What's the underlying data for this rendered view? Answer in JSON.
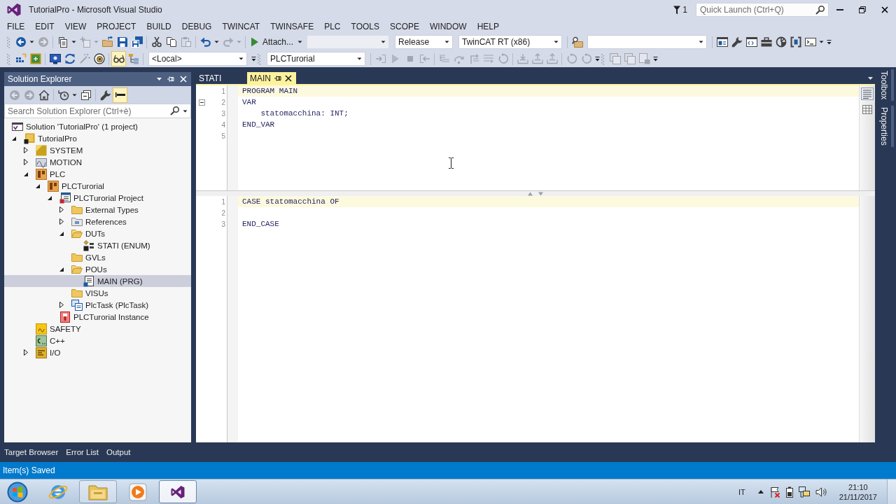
{
  "window": {
    "title": "TutorialPro - Microsoft Visual Studio",
    "notification_count": "1",
    "quick_launch": {
      "placeholder": "Quick Launch (Ctrl+Q)"
    }
  },
  "menu": [
    "FILE",
    "EDIT",
    "VIEW",
    "PROJECT",
    "BUILD",
    "DEBUG",
    "TWINCAT",
    "TWINSAFE",
    "PLC",
    "TOOLS",
    "SCOPE",
    "WINDOW",
    "HELP"
  ],
  "toolbar_1": [
    {
      "kind": "grip"
    },
    {
      "kind": "back",
      "disabled": false
    },
    {
      "kind": "dropdown",
      "disabled": false
    },
    {
      "kind": "forward",
      "disabled": true
    },
    {
      "kind": "separator"
    },
    {
      "kind": "new-project",
      "disabled": false
    },
    {
      "kind": "dropdown",
      "disabled": false
    },
    {
      "kind": "add-item",
      "disabled": true
    },
    {
      "kind": "dropdown",
      "disabled": true
    },
    {
      "kind": "open",
      "disabled": false
    },
    {
      "kind": "save",
      "disabled": false
    },
    {
      "kind": "save-all",
      "disabled": false
    },
    {
      "kind": "separator"
    },
    {
      "kind": "cut",
      "disabled": false
    },
    {
      "kind": "copy",
      "disabled": false
    },
    {
      "kind": "paste",
      "disabled": true
    },
    {
      "kind": "separator"
    },
    {
      "kind": "undo",
      "disabled": false
    },
    {
      "kind": "dropdown",
      "disabled": false
    },
    {
      "kind": "redo",
      "disabled": true
    },
    {
      "kind": "dropdown",
      "disabled": true
    },
    {
      "kind": "separator"
    },
    {
      "kind": "start",
      "label": "Attach...",
      "disabled": false
    },
    {
      "kind": "dropdown",
      "disabled": false
    },
    {
      "kind": "combo",
      "disabled": true
    },
    {
      "kind": "combo",
      "value": "Release",
      "disabled": false
    },
    {
      "kind": "combo",
      "value": "TwinCAT RT (x86)",
      "disabled": false
    },
    {
      "kind": "separator"
    },
    {
      "kind": "find-files",
      "disabled": false
    },
    {
      "kind": "combo",
      "disabled": false
    },
    {
      "kind": "separator"
    },
    {
      "kind": "solution-explorer",
      "disabled": false
    },
    {
      "kind": "properties",
      "disabled": false
    },
    {
      "kind": "code-window",
      "disabled": false
    },
    {
      "kind": "toolbox",
      "disabled": false
    },
    {
      "kind": "gauge",
      "disabled": false
    },
    {
      "kind": "brackets",
      "disabled": false
    },
    {
      "kind": "console",
      "disabled": false
    },
    {
      "kind": "dropdown",
      "disabled": false
    },
    {
      "kind": "overflow"
    }
  ],
  "toolbar_2": [
    {
      "kind": "grip"
    },
    {
      "kind": "grid-arrow",
      "disabled": false
    },
    {
      "kind": "chip",
      "disabled": false
    },
    {
      "kind": "separator"
    },
    {
      "kind": "monitor",
      "disabled": false
    },
    {
      "kind": "reload",
      "disabled": false
    },
    {
      "kind": "wand",
      "disabled": true
    },
    {
      "kind": "target",
      "disabled": false
    },
    {
      "kind": "separator"
    },
    {
      "kind": "glasses",
      "disabled": false,
      "checked": true
    },
    {
      "kind": "hierarchy",
      "disabled": false
    },
    {
      "kind": "separator"
    },
    {
      "kind": "combo",
      "value": "<Local>",
      "disabled": false
    },
    {
      "kind": "overflow"
    },
    {
      "kind": "grip"
    },
    {
      "kind": "combo",
      "value": "PLCTurorial",
      "disabled": false
    },
    {
      "kind": "separator"
    },
    {
      "kind": "login",
      "disabled": true
    },
    {
      "kind": "start",
      "disabled": true
    },
    {
      "kind": "stop",
      "disabled": true
    },
    {
      "kind": "logout",
      "disabled": true
    },
    {
      "kind": "separator"
    },
    {
      "kind": "step-into",
      "disabled": true
    },
    {
      "kind": "step-over",
      "disabled": true
    },
    {
      "kind": "step-out",
      "disabled": true
    },
    {
      "kind": "run-to-cursor",
      "disabled": true
    },
    {
      "kind": "reset",
      "disabled": true
    },
    {
      "kind": "separator"
    },
    {
      "kind": "tray-down",
      "disabled": true
    },
    {
      "kind": "tray-up",
      "disabled": true
    },
    {
      "kind": "tray-up",
      "disabled": true
    },
    {
      "kind": "separator"
    },
    {
      "kind": "reset",
      "disabled": true
    },
    {
      "kind": "reset",
      "disabled": true
    },
    {
      "kind": "overflow"
    },
    {
      "kind": "grip"
    },
    {
      "kind": "window-split",
      "disabled": true
    },
    {
      "kind": "window-split",
      "disabled": true
    },
    {
      "kind": "window-lock",
      "disabled": true
    },
    {
      "kind": "overflow"
    }
  ],
  "solution_explorer": {
    "title": "Solution Explorer",
    "toolbar": [
      {
        "kind": "back",
        "disabled": true
      },
      {
        "kind": "forward",
        "disabled": true
      },
      {
        "kind": "home",
        "disabled": false
      },
      {
        "kind": "separator"
      },
      {
        "kind": "history",
        "disabled": false
      },
      {
        "kind": "dropdown",
        "disabled": false
      },
      {
        "kind": "collapse-all",
        "disabled": false
      },
      {
        "kind": "separator"
      },
      {
        "kind": "properties",
        "disabled": false
      },
      {
        "kind": "preview",
        "disabled": false,
        "checked": true
      }
    ],
    "search": {
      "placeholder": "Search Solution Explorer (Ctrl+è)"
    },
    "tree": [
      {
        "label": "Solution 'TutorialPro' (1 project)",
        "kind": "solution",
        "selected": false,
        "children": [
          {
            "label": "TutorialPro",
            "kind": "twincat-project",
            "expanded": true,
            "selected": false,
            "children": [
              {
                "label": "SYSTEM",
                "kind": "system",
                "expanded": false,
                "selected": false
              },
              {
                "label": "MOTION",
                "kind": "motion",
                "expanded": false,
                "selected": false
              },
              {
                "label": "PLC",
                "kind": "plc",
                "expanded": true,
                "selected": false,
                "children": [
                  {
                    "label": "PLCTurorial",
                    "kind": "plc-project",
                    "expanded": true,
                    "selected": false,
                    "children": [
                      {
                        "label": "PLCTurorial Project",
                        "kind": "plc-project-file",
                        "expanded": true,
                        "selected": false,
                        "children": [
                          {
                            "label": "External Types",
                            "kind": "folder",
                            "expanded": false,
                            "selected": false
                          },
                          {
                            "label": "References",
                            "kind": "references",
                            "expanded": false,
                            "selected": false
                          },
                          {
                            "label": "DUTs",
                            "kind": "folder",
                            "expanded": true,
                            "selected": false,
                            "children": [
                              {
                                "label": "STATI (ENUM)",
                                "kind": "enum",
                                "selected": false
                              }
                            ]
                          },
                          {
                            "label": "GVLs",
                            "kind": "folder",
                            "selected": false
                          },
                          {
                            "label": "POUs",
                            "kind": "folder",
                            "expanded": true,
                            "selected": false,
                            "children": [
                              {
                                "label": "MAIN (PRG)",
                                "kind": "program",
                                "selected": true
                              }
                            ]
                          },
                          {
                            "label": "VISUs",
                            "kind": "folder",
                            "selected": false
                          },
                          {
                            "label": "PlcTask (PlcTask)",
                            "kind": "task",
                            "expanded": false,
                            "selected": false
                          }
                        ]
                      },
                      {
                        "label": "PLCTurorial Instance",
                        "kind": "instance",
                        "selected": false
                      }
                    ]
                  }
                ]
              },
              {
                "label": "SAFETY",
                "kind": "safety",
                "selected": false
              },
              {
                "label": "C++",
                "kind": "cpp",
                "selected": false
              },
              {
                "label": "I/O",
                "kind": "io",
                "expanded": false,
                "selected": false
              }
            ]
          }
        ]
      }
    ]
  },
  "editor": {
    "tabs": [
      {
        "label": "STATI",
        "selected": false
      },
      {
        "label": "MAIN",
        "selected": true
      }
    ],
    "declaration_views": [
      {
        "kind": "text",
        "selected": true
      },
      {
        "kind": "table",
        "selected": false
      }
    ],
    "declaration": [
      {
        "number": "1",
        "code": "PROGRAM MAIN",
        "current": true
      },
      {
        "number": "2",
        "code": "VAR",
        "current": false,
        "fold_marker": true
      },
      {
        "number": "3",
        "code": "    statomacchina: INT;",
        "current": false
      },
      {
        "number": "4",
        "code": "END_VAR",
        "current": false
      },
      {
        "number": "5",
        "current": false
      }
    ],
    "implementation": [
      {
        "number": "1",
        "code": "CASE statomacchina OF",
        "current": true
      },
      {
        "number": "2",
        "current": false
      },
      {
        "number": "3",
        "code": "END_CASE",
        "current": false
      }
    ]
  },
  "side_tabs": [
    "Toolbox",
    "Properties"
  ],
  "bottom_tabs": [
    "Target Browser",
    "Error List",
    "Output"
  ],
  "status_bar": {
    "message": "Item(s) Saved"
  },
  "taskbar": {
    "apps": [
      {
        "kind": "browser",
        "running": false,
        "selected": false
      },
      {
        "kind": "file-manager",
        "running": true,
        "selected": false
      },
      {
        "kind": "media-player",
        "running": false,
        "selected": false
      },
      {
        "kind": "ide",
        "running": true,
        "selected": true
      }
    ],
    "language": "IT",
    "time": "21:10",
    "date": "21/11/2017"
  }
}
